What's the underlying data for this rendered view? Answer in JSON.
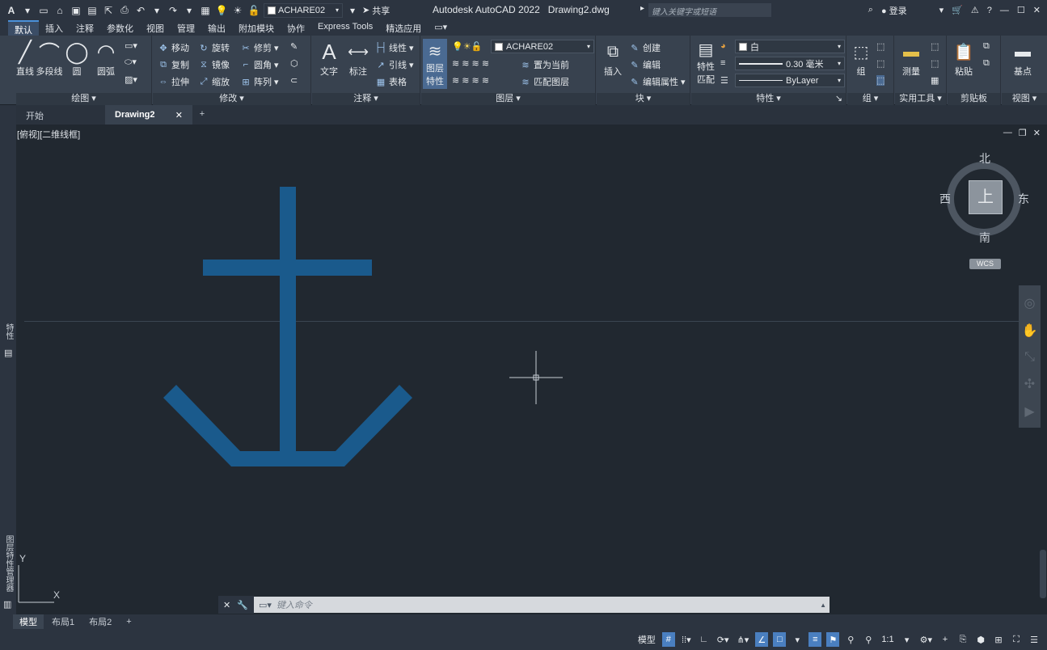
{
  "titlebar": {
    "app_title": "Autodesk AutoCAD 2022",
    "file_name": "Drawing2.dwg",
    "layer_name": "ACHARE02",
    "share_label": "共享",
    "search_placeholder": "键入关键字或短语",
    "login_label": "登录"
  },
  "ribbon_tabs": [
    "默认",
    "插入",
    "注释",
    "参数化",
    "视图",
    "管理",
    "输出",
    "附加模块",
    "协作",
    "Express Tools",
    "精选应用"
  ],
  "panels": {
    "draw": {
      "title": "绘图",
      "line": "直线",
      "polyline": "多段线",
      "circle": "圆",
      "arc": "圆弧"
    },
    "modify": {
      "title": "修改",
      "move": "移动",
      "rotate": "旋转",
      "trim": "修剪",
      "copy": "复制",
      "mirror": "镜像",
      "fillet": "圆角",
      "stretch": "拉伸",
      "scale": "缩放",
      "array": "阵列"
    },
    "annotation": {
      "title": "注释",
      "text": "文字",
      "dimension": "标注",
      "linear": "线性",
      "leader": "引线",
      "table": "表格"
    },
    "layers": {
      "title": "图层",
      "layer_properties_l1": "图层",
      "layer_properties_l2": "特性",
      "layer_name": "ACHARE02",
      "set_current": "置为当前",
      "match_layer": "匹配图层"
    },
    "block": {
      "title": "块",
      "insert": "插入",
      "create": "创建",
      "edit": "编辑",
      "edit_attr": "编辑属性"
    },
    "properties": {
      "title": "特性",
      "match_l1": "特性",
      "match_l2": "匹配",
      "color": "白",
      "lineweight": "0.30 毫米",
      "linetype": "ByLayer"
    },
    "groups": {
      "title": "组",
      "group": "组"
    },
    "utilities": {
      "title": "实用工具",
      "measure": "测量"
    },
    "clipboard": {
      "title": "剪贴板",
      "paste": "粘贴"
    },
    "view": {
      "title": "视图",
      "base": "基点"
    }
  },
  "doc_tabs": {
    "start": "开始",
    "drawing": "Drawing2"
  },
  "viewport": {
    "label": "[俯视][二维线框]",
    "compass": {
      "north": "北",
      "south": "南",
      "east": "东",
      "west": "西",
      "face": "上"
    },
    "wcs": "WCS",
    "ucs_y": "Y",
    "ucs_x": "X",
    "anchor_color": "#1a5a8c"
  },
  "left_palettes": {
    "props": "特性",
    "layer_states": "图层特性管理器"
  },
  "command": {
    "placeholder": "键入命令"
  },
  "layout_tabs": [
    "模型",
    "布局1",
    "布局2"
  ],
  "status": {
    "model": "模型",
    "scale": "1:1"
  }
}
